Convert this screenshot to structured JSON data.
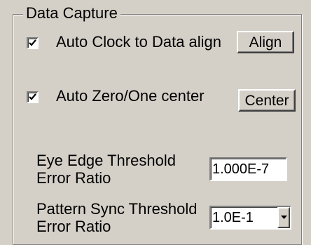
{
  "group": {
    "title": "Data Capture"
  },
  "auto_clock": {
    "label": "Auto Clock to Data align",
    "checked": true,
    "button_label": "Align"
  },
  "auto_zero": {
    "label": "Auto Zero/One center",
    "checked": true,
    "button_label": "Center"
  },
  "eye_edge": {
    "label_line1": "Eye Edge Threshold",
    "label_line2": "Error Ratio",
    "value": "1.000E-7"
  },
  "pattern_sync": {
    "label_line1": "Pattern Sync Threshold",
    "label_line2": "Error Ratio",
    "selected": "1.0E-1"
  },
  "icons": {
    "check": "check-icon",
    "dropdown": "chevron-down-icon"
  }
}
